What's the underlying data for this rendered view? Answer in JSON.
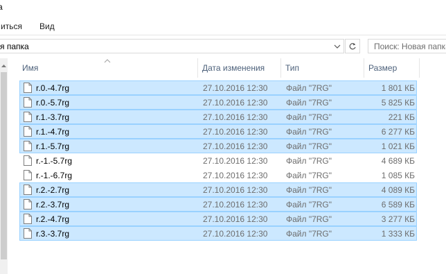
{
  "window": {
    "title_fragment": "а"
  },
  "ribbon": {
    "tabs": [
      {
        "label": "иться"
      },
      {
        "label": "Вид"
      }
    ]
  },
  "address": {
    "path_fragment": "я папка"
  },
  "search": {
    "placeholder": "Поиск: Новая папка"
  },
  "columns": {
    "name": "Имя",
    "date": "Дата изменения",
    "type": "Тип",
    "size": "Размер"
  },
  "files": [
    {
      "name": "r.0.-4.7rg",
      "date": "27.10.2016 12:30",
      "type": "Файл \"7RG\"",
      "size": "1 801 КБ",
      "selected": true
    },
    {
      "name": "r.0.-5.7rg",
      "date": "27.10.2016 12:30",
      "type": "Файл \"7RG\"",
      "size": "5 825 КБ",
      "selected": true
    },
    {
      "name": "r.1.-3.7rg",
      "date": "27.10.2016 12:30",
      "type": "Файл \"7RG\"",
      "size": "221 КБ",
      "selected": true
    },
    {
      "name": "r.1.-4.7rg",
      "date": "27.10.2016 12:30",
      "type": "Файл \"7RG\"",
      "size": "6 277 КБ",
      "selected": true
    },
    {
      "name": "r.1.-5.7rg",
      "date": "27.10.2016 12:30",
      "type": "Файл \"7RG\"",
      "size": "1 021 КБ",
      "selected": true
    },
    {
      "name": "r.-1.-5.7rg",
      "date": "27.10.2016 12:30",
      "type": "Файл \"7RG\"",
      "size": "4 689 КБ",
      "selected": false
    },
    {
      "name": "r.-1.-6.7rg",
      "date": "27.10.2016 12:30",
      "type": "Файл \"7RG\"",
      "size": "1 085 КБ",
      "selected": false
    },
    {
      "name": "r.2.-2.7rg",
      "date": "27.10.2016 12:30",
      "type": "Файл \"7RG\"",
      "size": "4 089 КБ",
      "selected": true
    },
    {
      "name": "r.2.-3.7rg",
      "date": "27.10.2016 12:30",
      "type": "Файл \"7RG\"",
      "size": "6 589 КБ",
      "selected": true
    },
    {
      "name": "r.2.-4.7rg",
      "date": "27.10.2016 12:30",
      "type": "Файл \"7RG\"",
      "size": "3 277 КБ",
      "selected": true
    },
    {
      "name": "r.3.-3.7rg",
      "date": "27.10.2016 12:30",
      "type": "Файл \"7RG\"",
      "size": "1 333 КБ",
      "selected": true
    }
  ],
  "colors": {
    "selection_bg": "#cce8ff",
    "selection_border": "#99d1ff",
    "header_text": "#4c607a",
    "meta_text": "#6d6d6d"
  },
  "icons": {
    "file": "document-icon",
    "dropdown": "chevron-down-icon",
    "refresh": "refresh-icon",
    "sort": "sort-ascending-icon",
    "scroll_up": "scroll-up-icon"
  }
}
